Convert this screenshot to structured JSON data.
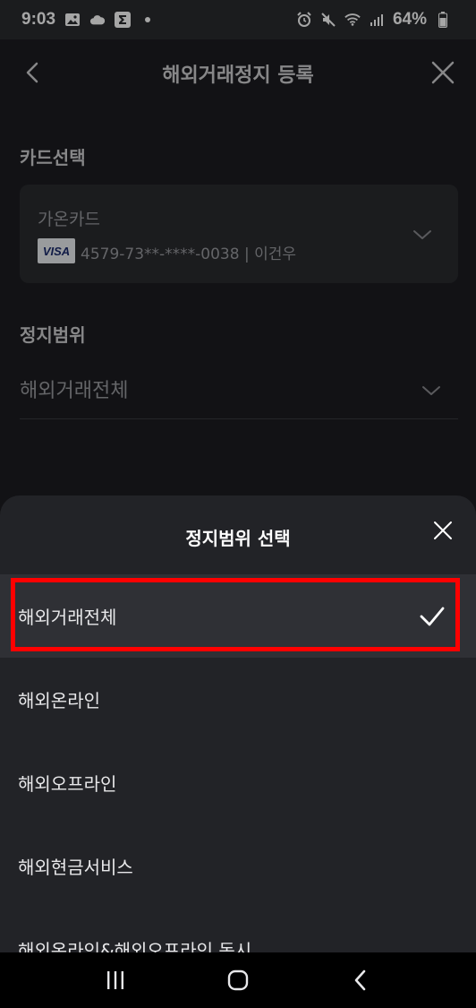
{
  "status_bar": {
    "time": "9:03",
    "battery": "64%",
    "left_icons": [
      "gallery-icon",
      "cloud-icon",
      "sigma-app-icon",
      "dot-icon"
    ],
    "right_icons": [
      "alarm-icon",
      "mute-icon",
      "wifi-icon",
      "signal-icon",
      "battery-icon"
    ]
  },
  "header": {
    "title": "해외거래정지 등록",
    "back_icon": "chevron-left-icon",
    "close_icon": "close-icon"
  },
  "card_section": {
    "label": "카드선택",
    "card_name": "가온카드",
    "card_brand": "VISA",
    "card_number": "4579-73**-****-0038 | 이건우"
  },
  "range_section": {
    "label": "정지범위",
    "value": "해외거래전체"
  },
  "sheet": {
    "title": "정지범위 선택",
    "options": [
      {
        "label": "해외거래전체",
        "selected": true
      },
      {
        "label": "해외온라인",
        "selected": false
      },
      {
        "label": "해외오프라인",
        "selected": false
      },
      {
        "label": "해외현금서비스",
        "selected": false
      },
      {
        "label": "해외온라인&해외오프라인 동시",
        "selected": false
      }
    ]
  },
  "nav_bar": {
    "icons": [
      "recent-apps-icon",
      "home-icon",
      "back-icon"
    ]
  },
  "colors": {
    "highlight": "#ff0000",
    "sheet_bg": "#222327",
    "selected_bg": "#2f3035"
  }
}
